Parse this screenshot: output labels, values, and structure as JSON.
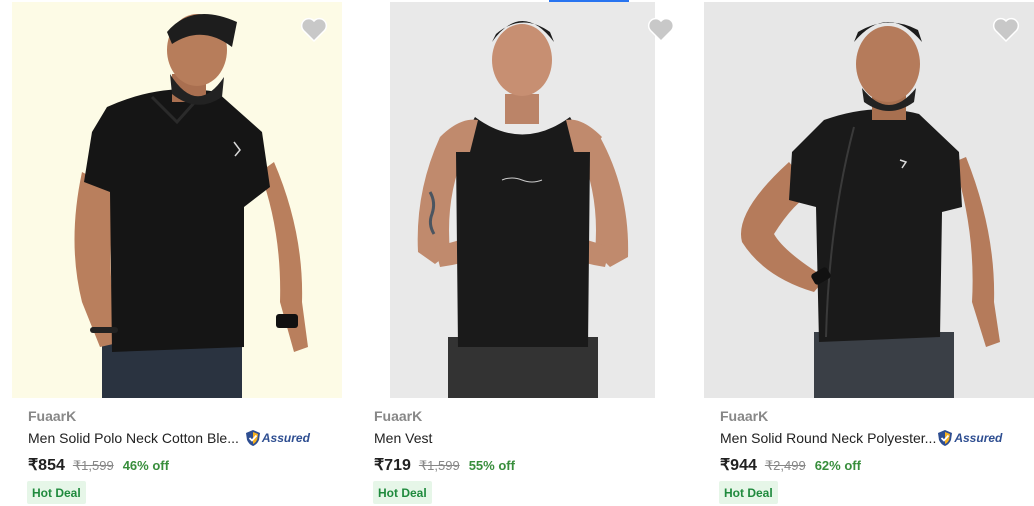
{
  "colors": {
    "accent": "#2874f0",
    "discount": "#388e3c",
    "badge_bg": "#e6f6e8",
    "badge_text": "#1f8a3d",
    "wishlist_heart": "#c8c8c8"
  },
  "products": [
    {
      "brand": "FuaarK",
      "title": "Men Solid Polo Neck Cotton Ble...",
      "assured": true,
      "price": "₹854",
      "mrp": "₹1,599",
      "discount": "46% off",
      "badge": "Hot Deal",
      "image_icon": "model-black-polo-tshirt",
      "wishlist_icon": "heart-icon"
    },
    {
      "brand": "FuaarK",
      "title": "Men Vest",
      "assured": false,
      "price": "₹719",
      "mrp": "₹1,599",
      "discount": "55% off",
      "badge": "Hot Deal",
      "image_icon": "model-black-vest",
      "wishlist_icon": "heart-icon"
    },
    {
      "brand": "FuaarK",
      "title": "Men Solid Round Neck Polyester...",
      "assured": true,
      "price": "₹944",
      "mrp": "₹2,499",
      "discount": "62% off",
      "badge": "Hot Deal",
      "image_icon": "model-black-round-neck-tshirt",
      "wishlist_icon": "heart-icon"
    }
  ],
  "assured_label": "Assured"
}
